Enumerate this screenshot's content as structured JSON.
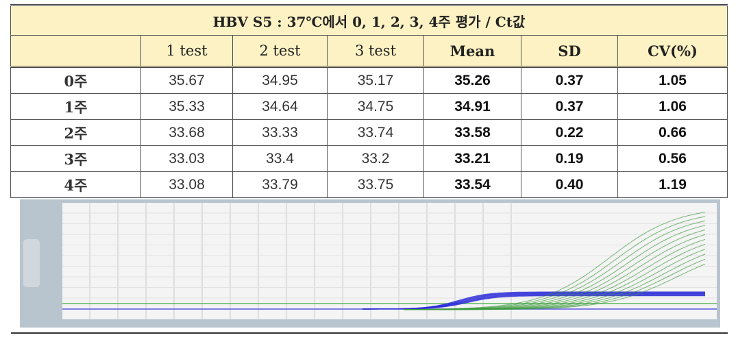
{
  "table": {
    "title": "HBV S5 : 37℃에서 0, 1, 2, 3, 4주 평가 / Ct값",
    "headers": [
      "",
      "1 test",
      "2 test",
      "3 test",
      "Mean",
      "SD",
      "CV(%)"
    ],
    "rows": [
      [
        "0주",
        "35.67",
        "34.95",
        "35.17",
        "35.26",
        "0.37",
        "1.05"
      ],
      [
        "1주",
        "35.33",
        "34.64",
        "34.75",
        "34.91",
        "0.37",
        "1.06"
      ],
      [
        "2주",
        "33.68",
        "33.33",
        "33.74",
        "33.58",
        "0.22",
        "0.66"
      ],
      [
        "3주",
        "33.03",
        "33.4",
        "33.2",
        "33.21",
        "0.19",
        "0.56"
      ],
      [
        "4주",
        "33.08",
        "33.79",
        "33.75",
        "33.54",
        "0.40",
        "1.19"
      ]
    ]
  },
  "figure": {
    "type": "amplification-plot-image",
    "colors": {
      "frame": "#b8c4ce",
      "plot_bg": "#f4f4f4",
      "target_curves": "#3c9a3c",
      "ic_curves": "#2a2ad8",
      "threshold_green": "#5cb85c",
      "threshold_blue": "#5a5ae0"
    }
  }
}
